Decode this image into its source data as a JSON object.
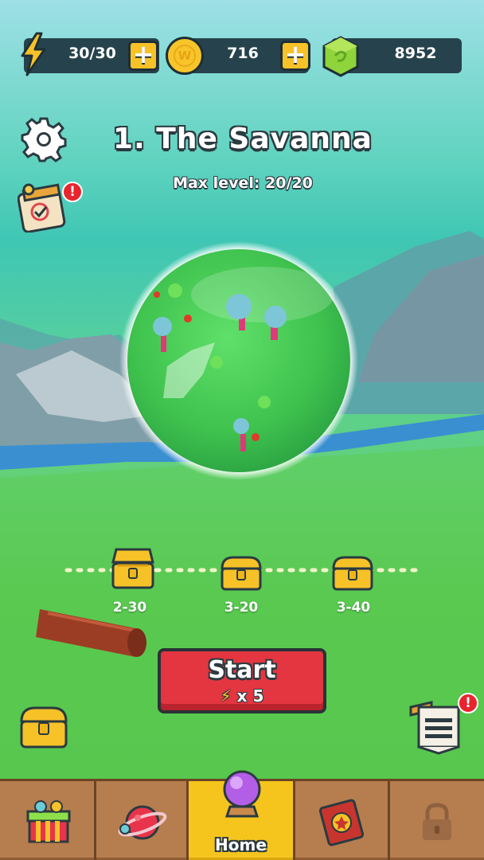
{
  "hud": {
    "energy": "30/30",
    "coins": "716",
    "gems": "8952",
    "coin_symbol": "W"
  },
  "level": {
    "title": "1. The Savanna",
    "max_level": "Max level: 20/20"
  },
  "rewards": [
    {
      "label": "2-30"
    },
    {
      "label": "3-20"
    },
    {
      "label": "3-40"
    }
  ],
  "start_button": {
    "label": "Start",
    "cost": "x 5"
  },
  "badges": {
    "quests": "!",
    "mail": "!"
  },
  "nav": {
    "tabs": [
      {
        "name": "shop-tab",
        "icon": "gift-box-icon"
      },
      {
        "name": "planets-tab",
        "icon": "planet-icon"
      },
      {
        "name": "home-tab",
        "icon": "crystal-ball-icon",
        "label": "Home",
        "active": true
      },
      {
        "name": "book-tab",
        "icon": "spellbook-icon"
      },
      {
        "name": "locked-tab",
        "icon": "lock-icon"
      }
    ]
  },
  "colors": {
    "hud_bg": "#26434d",
    "start_red": "#e33640",
    "nav_gold": "#f5c51d",
    "nav_brown": "#b67d4e"
  }
}
